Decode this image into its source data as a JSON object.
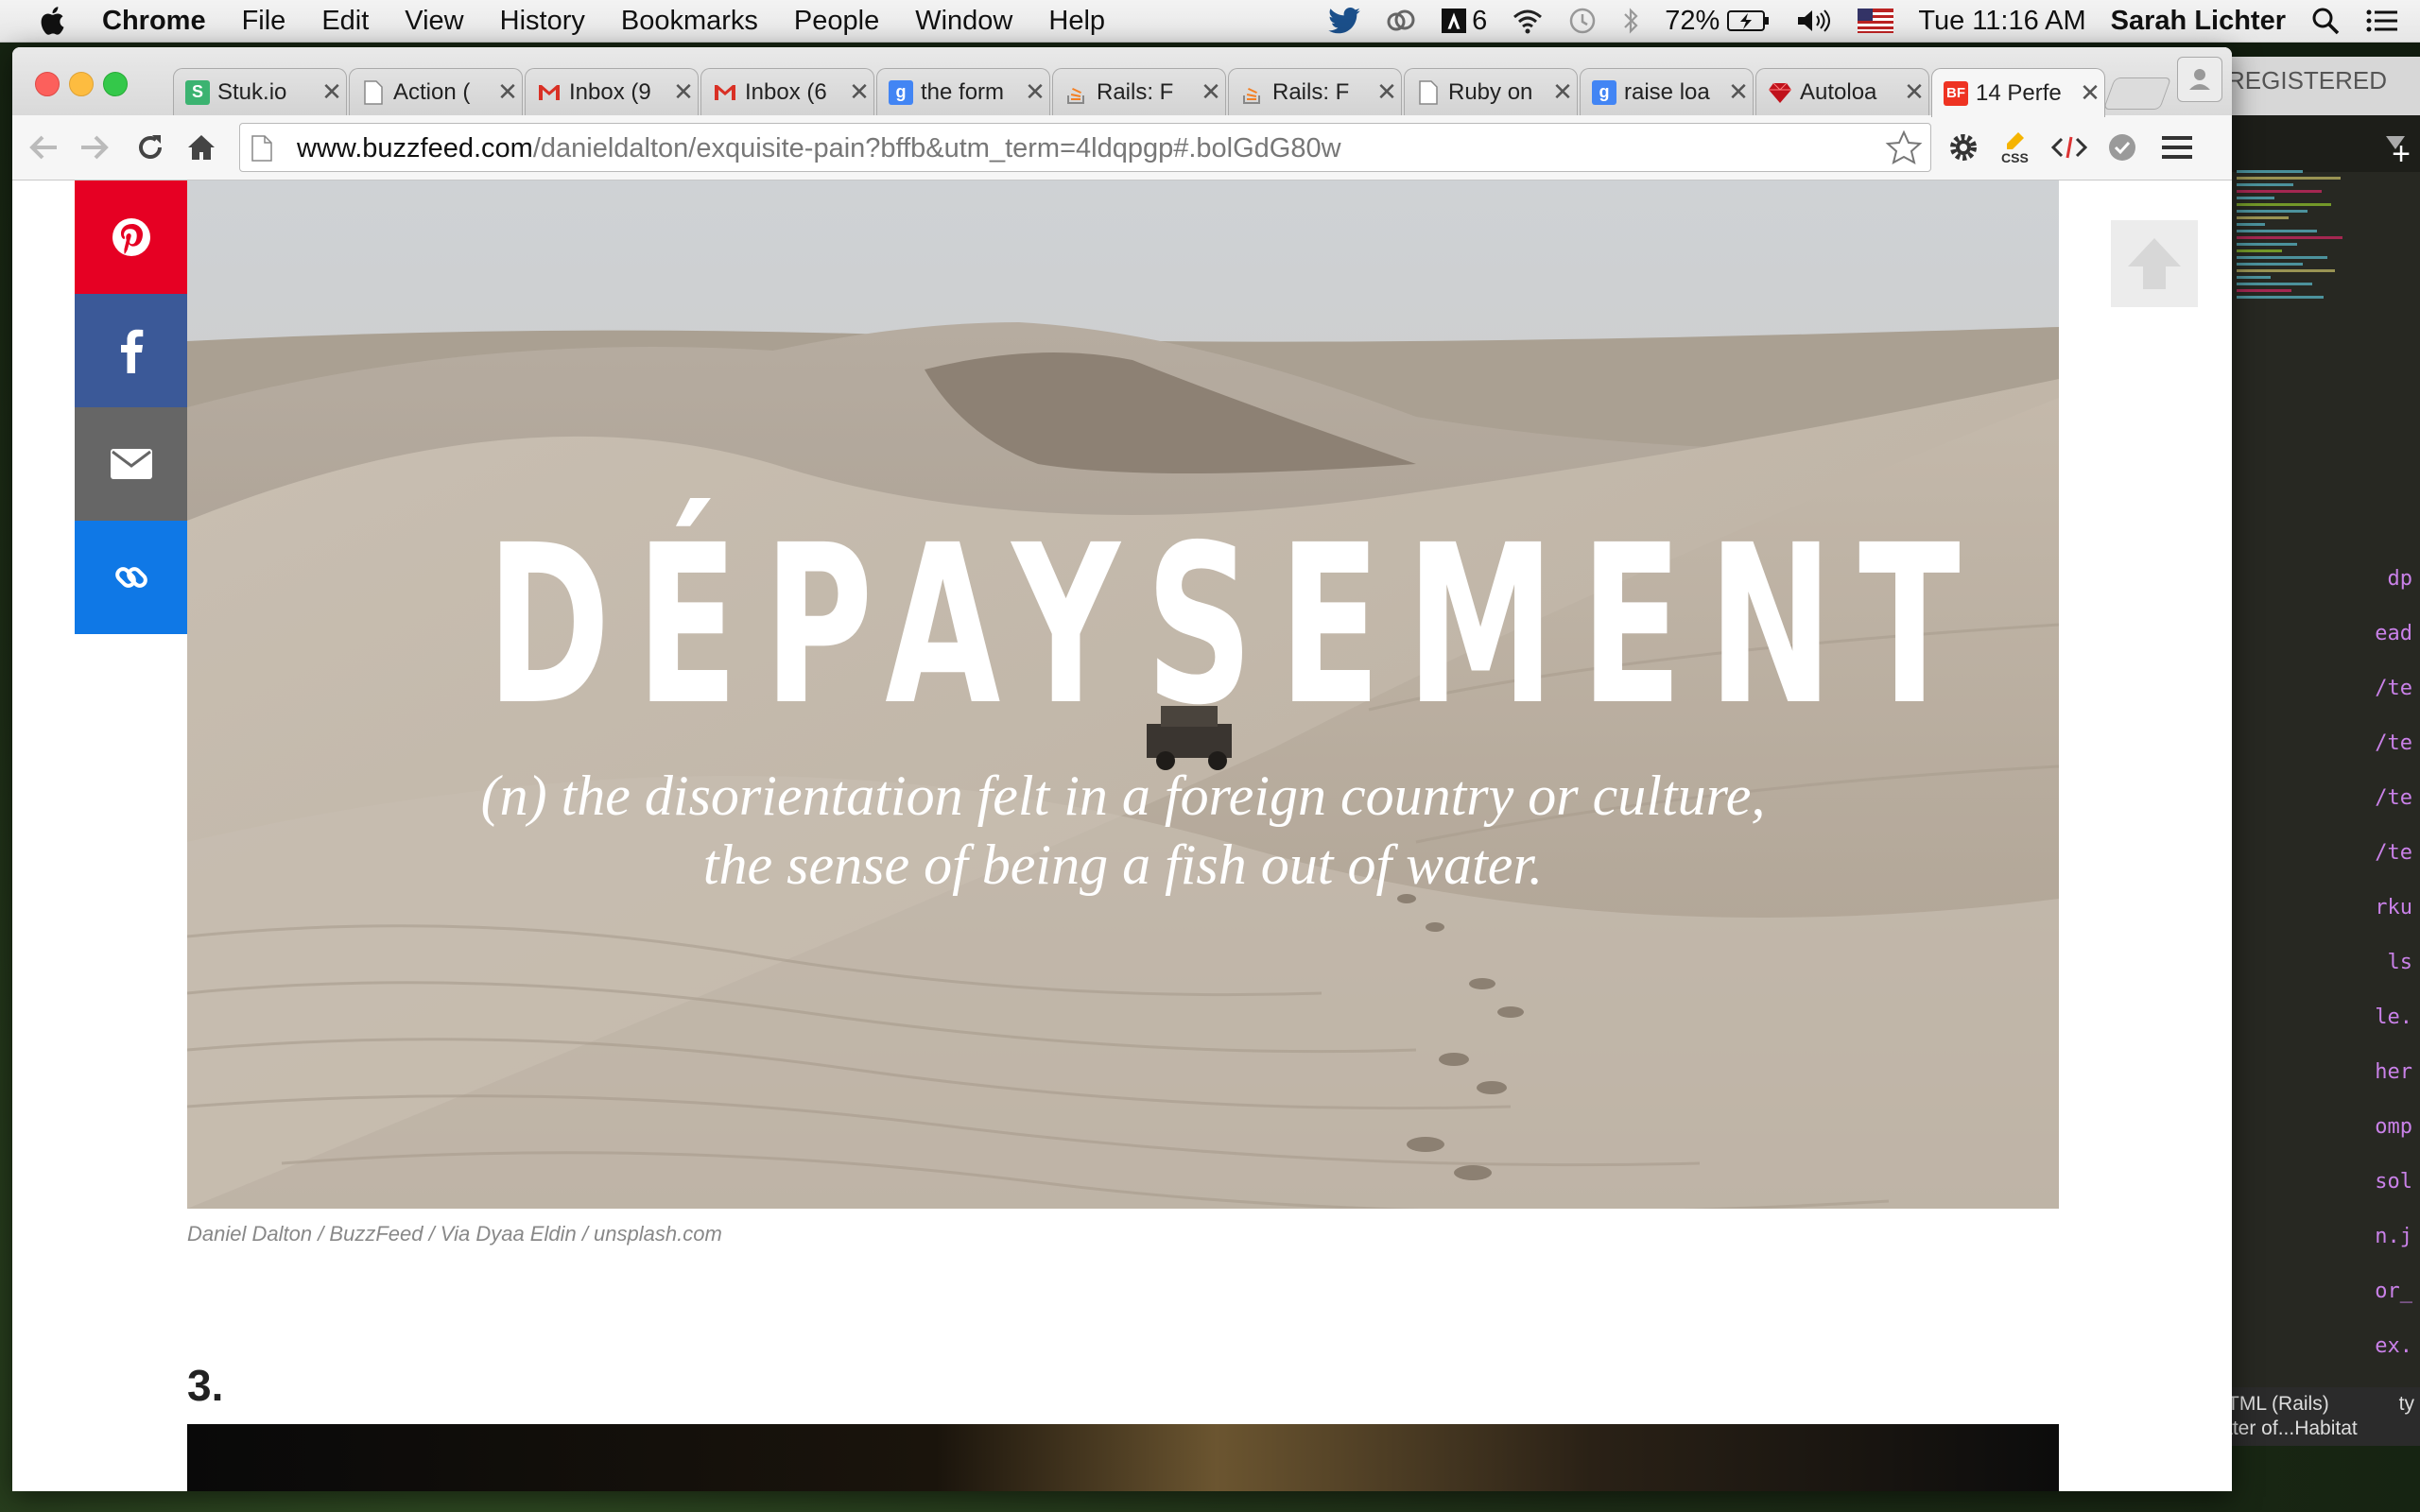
{
  "menubar": {
    "app": "Chrome",
    "menus": [
      "File",
      "Edit",
      "View",
      "History",
      "Bookmarks",
      "People",
      "Window",
      "Help"
    ],
    "adobe_count": "6",
    "battery": "72%",
    "clock": "Tue 11:16 AM",
    "user": "Sarah Lichter"
  },
  "tabs": [
    {
      "title": "Stuk.io",
      "favicon": "S",
      "fav_color": "#3cb371"
    },
    {
      "title": "Action (",
      "favicon": "",
      "fav_color": "page"
    },
    {
      "title": "Inbox (9",
      "favicon": "M",
      "fav_color": "gmail"
    },
    {
      "title": "Inbox (6",
      "favicon": "M",
      "fav_color": "gmail"
    },
    {
      "title": "the form",
      "favicon": "g",
      "fav_color": "#4285f4"
    },
    {
      "title": "Rails: F",
      "favicon": "",
      "fav_color": "stack"
    },
    {
      "title": "Rails: F",
      "favicon": "",
      "fav_color": "stack"
    },
    {
      "title": "Ruby on",
      "favicon": "",
      "fav_color": "page"
    },
    {
      "title": "raise loa",
      "favicon": "g",
      "fav_color": "#4285f4"
    },
    {
      "title": "Autoloa",
      "favicon": "",
      "fav_color": "ruby"
    },
    {
      "title": "14 Perfe",
      "favicon": "BF",
      "fav_color": "#e32"
    }
  ],
  "omnibox": {
    "host": "www.buzzfeed.com",
    "path": "/danieldalton/exquisite-pain?bffb&utm_term=4ldqpgp#.bolGdG80w"
  },
  "share_buttons": [
    {
      "name": "pinterest-icon",
      "color": "#e60023"
    },
    {
      "name": "facebook-icon",
      "color": "#3b5998"
    },
    {
      "name": "email-icon",
      "color": "#666666"
    },
    {
      "name": "link-icon",
      "color": "#0f78e6"
    }
  ],
  "hero": {
    "word": "DÉPAYSEMENT",
    "definition_line1": "(n) the disorientation felt in a foreign country or culture,",
    "definition_line2": "the sense of being a fish out of water."
  },
  "caption": "Daniel Dalton / BuzzFeed / Via Dyaa Eldin / unsplash.com",
  "next_item_number": "3.",
  "editor": {
    "header": "REGISTERED",
    "code_snippets": [
      "dp",
      "ead",
      "/te",
      "/te",
      "/te",
      "/te",
      "rku",
      "ls",
      "le.",
      "her",
      "omp",
      "sol",
      "n.j",
      "or_",
      "ex."
    ],
    "status_line1": "TML (Rails)",
    "status_line2": "tter of...Habitat",
    "status_right": "ty"
  }
}
